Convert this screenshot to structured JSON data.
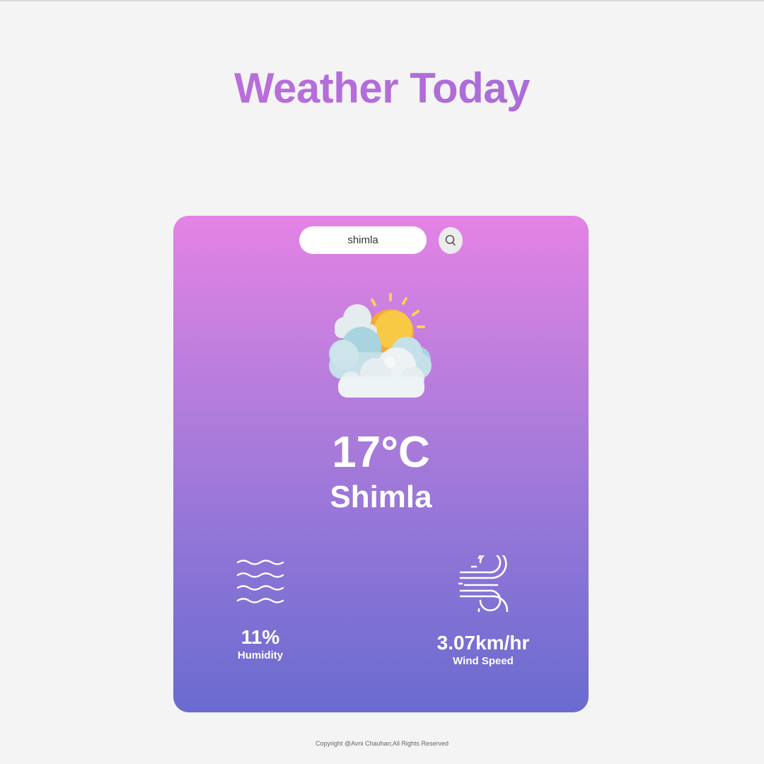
{
  "header": {
    "title": "Weather Today"
  },
  "search": {
    "value": "shimla",
    "icon": "search-icon"
  },
  "weather": {
    "icon": "partly-cloudy-icon",
    "temperature": "17°C",
    "city": "Shimla"
  },
  "details": {
    "humidity": {
      "icon": "humidity-waves-icon",
      "value": "11%",
      "label": "Humidity"
    },
    "wind": {
      "icon": "wind-icon",
      "value": "3.07km/hr",
      "label": "Wind Speed"
    }
  },
  "footer": {
    "copyright": "Copyright @Avni Chauhan;All Rights Reserved"
  },
  "colors": {
    "card_top": "#e483e5",
    "card_bottom": "#6a6bcf",
    "title": "#b36cd9",
    "page_background": "#f4f4f4"
  }
}
